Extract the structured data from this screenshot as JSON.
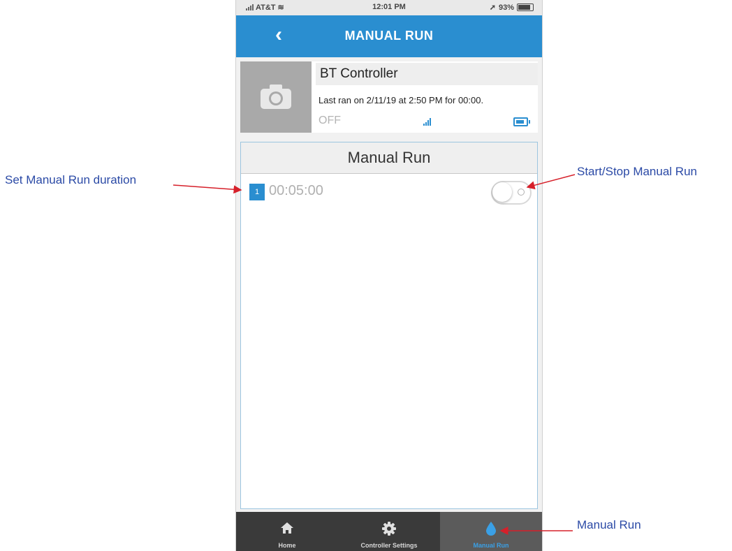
{
  "status_bar": {
    "carrier": "AT&T",
    "time": "12:01 PM",
    "battery": "93%"
  },
  "header": {
    "back_glyph": "‹",
    "title": "MANUAL RUN"
  },
  "controller": {
    "name": "BT Controller",
    "last_ran": "Last ran on 2/11/19 at 2:50 PM for 00:00.",
    "state": "OFF",
    "icons": [
      "camera-icon",
      "signal-icon",
      "battery-icon"
    ]
  },
  "manual_run": {
    "title": "Manual Run",
    "zones": [
      {
        "number": "1",
        "duration": "00:05:00",
        "running": false
      }
    ]
  },
  "bottom_nav": {
    "items": [
      {
        "label": "Home",
        "icon": "home-icon",
        "active": false
      },
      {
        "label": "Controller Settings",
        "icon": "gear-icon",
        "active": false
      },
      {
        "label": "Manual Run",
        "icon": "water-drop-icon",
        "active": true
      }
    ]
  },
  "annotations": {
    "set_duration": "Set Manual Run duration",
    "start_stop": "Start/Stop Manual Run",
    "manual_run_tab": "Manual Run"
  },
  "colors": {
    "accent": "#2a8ed0",
    "annotation_text": "#2b4aa6",
    "arrow": "#d6202a"
  }
}
